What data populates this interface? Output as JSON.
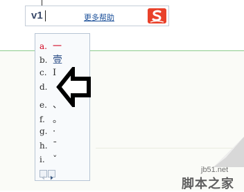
{
  "ime": {
    "input_text": "v1",
    "help_link": "更多帮助",
    "logo_letter": "S"
  },
  "candidates": [
    {
      "index": "a.",
      "char": "一",
      "selected": true
    },
    {
      "index": "b.",
      "char": "壹",
      "selected": false
    },
    {
      "index": "c.",
      "char": "Ⅰ",
      "selected": false
    },
    {
      "index": "d.",
      "char": "",
      "selected": false
    },
    {
      "index": "e.",
      "char": "、",
      "selected": false
    },
    {
      "index": "f.",
      "char": "。",
      "selected": false
    },
    {
      "index": "g.",
      "char": "·",
      "selected": false
    },
    {
      "index": "h.",
      "char": "ˉ",
      "selected": false
    },
    {
      "index": "i.",
      "char": "ˇ",
      "selected": false
    }
  ],
  "pager": {
    "prev_icon": "triangle-left-icon",
    "next_icon": "triangle-right-icon"
  },
  "annotation": {
    "icon": "arrow-left-outline-icon",
    "color": "#000000"
  },
  "watermark": {
    "site": "jb51.net",
    "name": "脚本之家"
  },
  "colors": {
    "selected_candidate": "#d1001c",
    "help_link": "#1a4f99",
    "logo": "#e9412a",
    "divider": "#8bcb8b"
  }
}
